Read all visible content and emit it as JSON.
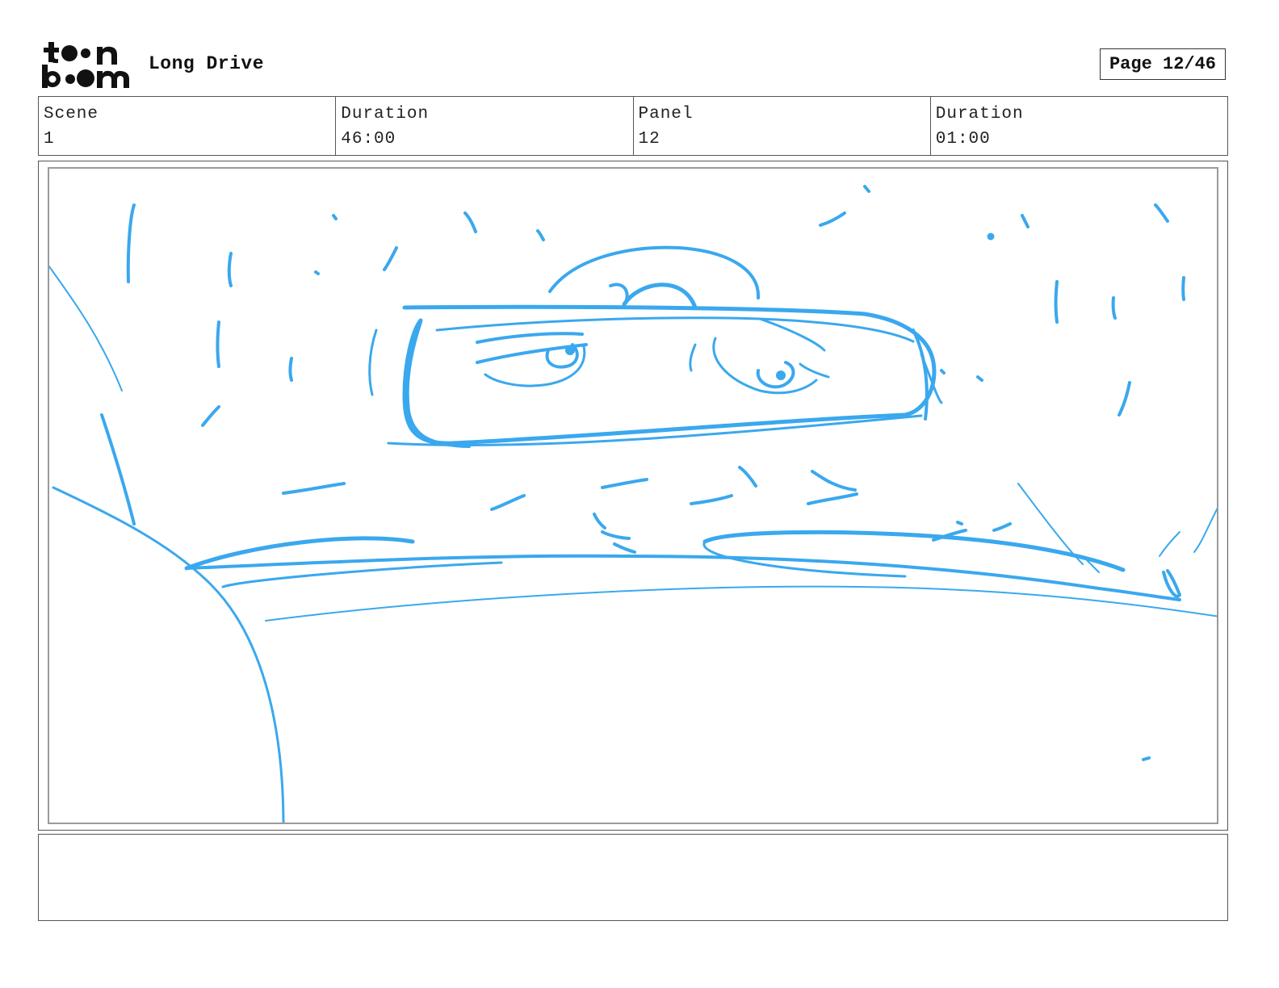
{
  "header": {
    "logo_name": "toonboom-logo",
    "project_title": "Long Drive",
    "page_indicator": "Page 12/46"
  },
  "info": {
    "scene_label": "Scene",
    "scene_value": "1",
    "scene_duration_label": "Duration",
    "scene_duration_value": "46:00",
    "panel_label": "Panel",
    "panel_value": "12",
    "panel_duration_label": "Duration",
    "panel_duration_value": "01:00"
  },
  "panel": {
    "sketch_color": "#3aa8ee",
    "notes": ""
  }
}
